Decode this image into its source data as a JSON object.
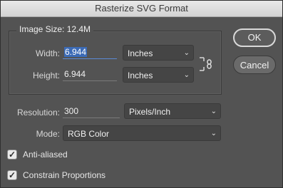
{
  "dialog": {
    "title": "Rasterize SVG Format"
  },
  "image_size": {
    "label": "Image Size: 12.4M"
  },
  "width": {
    "label": "Width:",
    "value": "6.944",
    "unit": "Inches"
  },
  "height": {
    "label": "Height:",
    "value": "6.944",
    "unit": "Inches"
  },
  "resolution": {
    "label": "Resolution:",
    "value": "300",
    "unit": "Pixels/Inch"
  },
  "mode": {
    "label": "Mode:",
    "value": "RGB Color"
  },
  "anti_aliased": {
    "label": "Anti-aliased",
    "checked": true
  },
  "constrain": {
    "label": "Constrain Proportions",
    "checked": true
  },
  "buttons": {
    "ok": "OK",
    "cancel": "Cancel"
  },
  "icons": {
    "chevron": "chevron-down-icon",
    "check": "checkmark-icon",
    "link": "chain-link-icon"
  }
}
